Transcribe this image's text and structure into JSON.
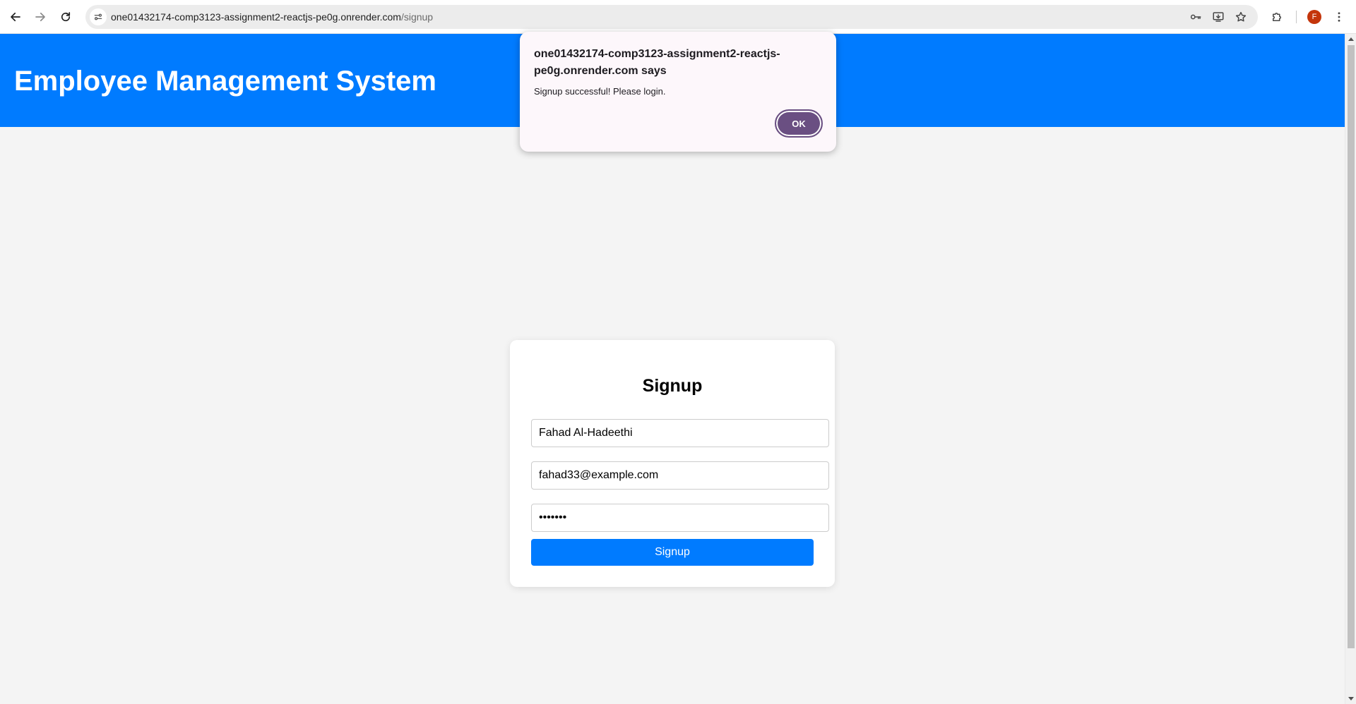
{
  "browser": {
    "url_host": "one01432174-comp3123-assignment2-reactjs-pe0g.onrender.com",
    "url_path": "/signup",
    "profile_initial": "F",
    "icons": {
      "back": "back-arrow-icon",
      "forward": "forward-arrow-icon",
      "reload": "reload-icon",
      "site_info": "site-info-icon",
      "password": "key-icon",
      "install": "install-app-icon",
      "bookmark": "star-icon",
      "extensions": "puzzle-icon",
      "menu": "kebab-menu-icon"
    }
  },
  "header": {
    "title": "Employee Management System",
    "background_color": "#007bff"
  },
  "signup_form": {
    "title": "Signup",
    "name_value": "Fahad Al-Hadeethi",
    "email_value": "fahad33@example.com",
    "password_value": "•••••••",
    "submit_label": "Signup",
    "button_color": "#007bff"
  },
  "alert": {
    "origin": "one01432174-comp3123-assignment2-reactjs-pe0g.onrender.com says",
    "message": "Signup successful! Please login.",
    "ok_label": "OK",
    "button_color": "#6a4f82"
  }
}
